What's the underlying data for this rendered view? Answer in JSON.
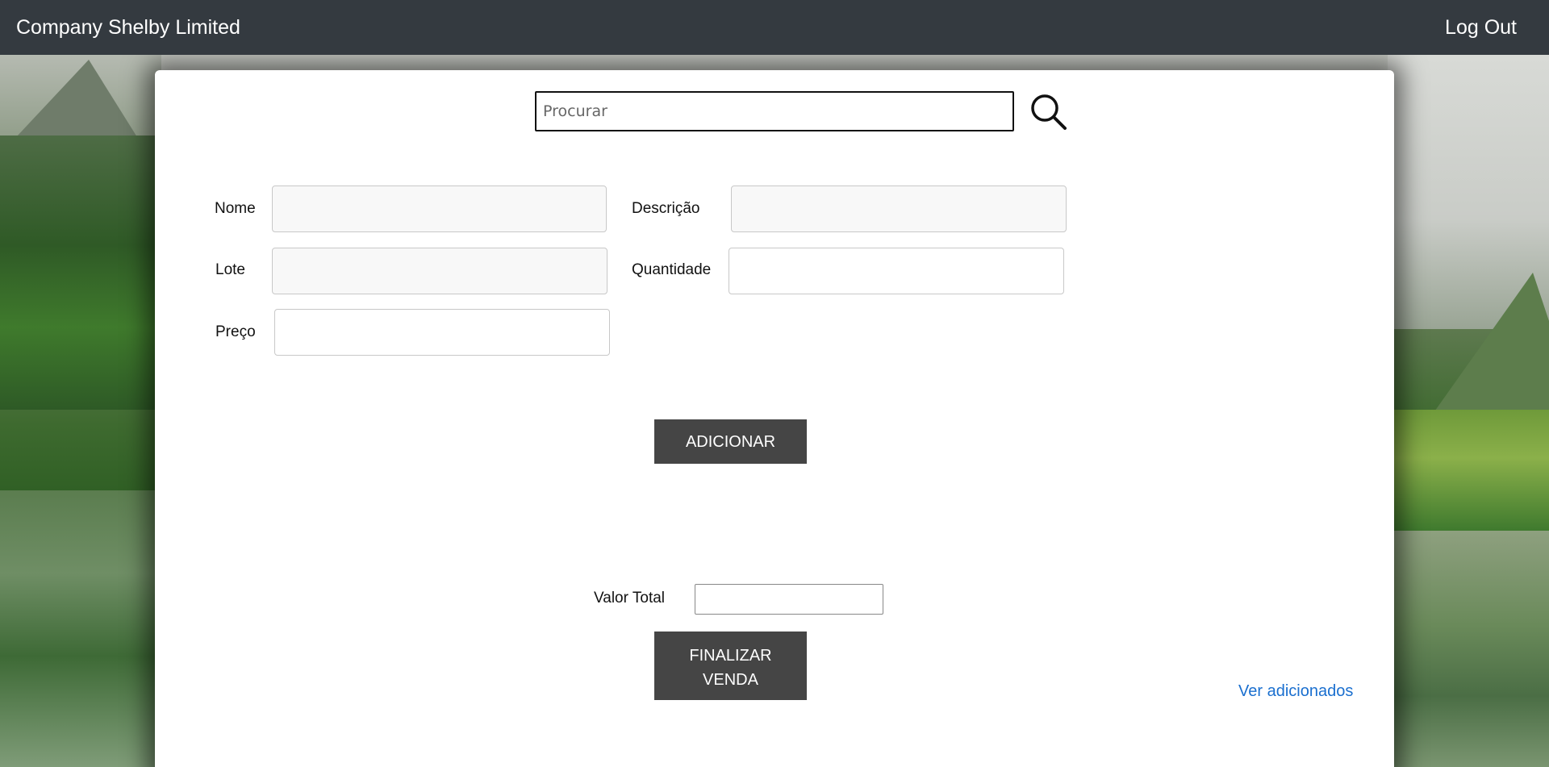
{
  "header": {
    "brand": "Company Shelby Limited",
    "logout_label": "Log Out"
  },
  "search": {
    "placeholder": "Procurar",
    "value": ""
  },
  "form": {
    "nome_label": "Nome",
    "descricao_label": "Descrição",
    "lote_label": "Lote",
    "quantidade_label": "Quantidade",
    "preco_label": "Preço",
    "nome_value": "",
    "descricao_value": "",
    "lote_value": "",
    "quantidade_value": "",
    "preco_value": ""
  },
  "actions": {
    "adicionar_label": "ADICIONAR",
    "finalizar_line1": "FINALIZAR",
    "finalizar_line2": "VENDA",
    "ver_adicionados_label": "Ver adicionados"
  },
  "total": {
    "label": "Valor Total",
    "value": ""
  },
  "icons": {
    "search": "search-icon"
  },
  "colors": {
    "topbar": "#343a40",
    "button": "#454545",
    "link": "#1a6fcf"
  }
}
